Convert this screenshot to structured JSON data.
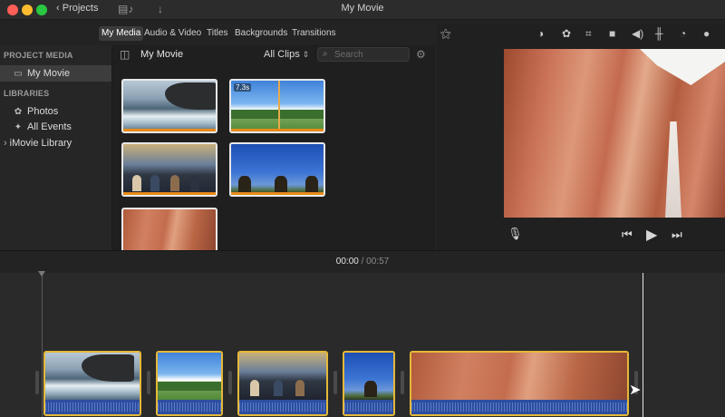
{
  "window": {
    "title": "My Movie",
    "projects_label": "Projects"
  },
  "tabs": [
    "My Media",
    "Audio & Video",
    "Titles",
    "Backgrounds",
    "Transitions"
  ],
  "sidebar": {
    "project_media_header": "PROJECT MEDIA",
    "project_item": "My Movie",
    "libraries_header": "LIBRARIES",
    "library_items": [
      "Photos",
      "All Events"
    ],
    "library_root": "iMovie Library"
  },
  "browser": {
    "title": "My Movie",
    "filter": "All Clips",
    "search_placeholder": "Search",
    "clips": [
      {
        "scene": "ocean"
      },
      {
        "scene": "park",
        "duration": "7.3s"
      },
      {
        "scene": "crowd"
      },
      {
        "scene": "sky"
      },
      {
        "scene": "canyon"
      }
    ]
  },
  "timeline": {
    "current": "00:00",
    "separator": "/",
    "total": "00:57"
  },
  "icons": {
    "back": "chevron-left-icon",
    "media_toggle": "media-browser-icon",
    "import": "download-arrow-icon",
    "magic": "magic-wand-icon",
    "color_balance": "color-balance-icon",
    "color_correction": "palette-icon",
    "crop": "crop-icon",
    "stabilization": "camera-icon",
    "volume": "speaker-icon",
    "noise": "equalizer-icon",
    "speed": "speedometer-icon",
    "filter": "clip-filter-icon",
    "mic": "microphone-icon",
    "prev": "skip-back-icon",
    "play": "play-icon",
    "next": "skip-forward-icon"
  },
  "colors": {
    "selection": "#e5b83a",
    "audio": "#2d4ea0",
    "clip_bar": "#e88a1a"
  }
}
